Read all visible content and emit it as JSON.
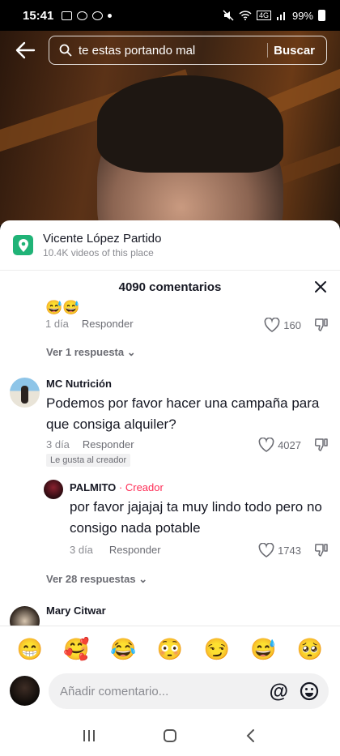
{
  "status_bar": {
    "time": "15:41",
    "battery": "99%"
  },
  "search": {
    "query": "te estas portando mal",
    "button_label": "Buscar"
  },
  "place": {
    "name": "Vicente López Partido",
    "subtitle": "10.4K videos of this place"
  },
  "comments": {
    "header": "4090 comentarios",
    "reply_label": "Responder",
    "items": [
      {
        "emoji": "😅😅",
        "age": "1 día",
        "likes": "160",
        "view_replies": "Ver 1 respuesta"
      },
      {
        "username": "MC Nutrición",
        "text": "Podemos por favor hacer una campaña para que consiga alquiler?",
        "age": "3 día",
        "likes": "4027",
        "liked_by_creator": "Le gusta al creador",
        "reply": {
          "username": "PALMITO",
          "tag": "Creador",
          "text": "por favor jajajaj ta muy lindo todo pero no consigo nada potable",
          "age": "3 día",
          "likes": "1743"
        },
        "view_replies": "Ver 28 respuestas"
      },
      {
        "username": "Mary Citwar"
      }
    ]
  },
  "emojis": [
    "😁",
    "🥰",
    "😂",
    "😳",
    "😏",
    "😅",
    "🥺"
  ],
  "comment_input": {
    "placeholder": "Añadir comentario...",
    "at_symbol": "@"
  }
}
